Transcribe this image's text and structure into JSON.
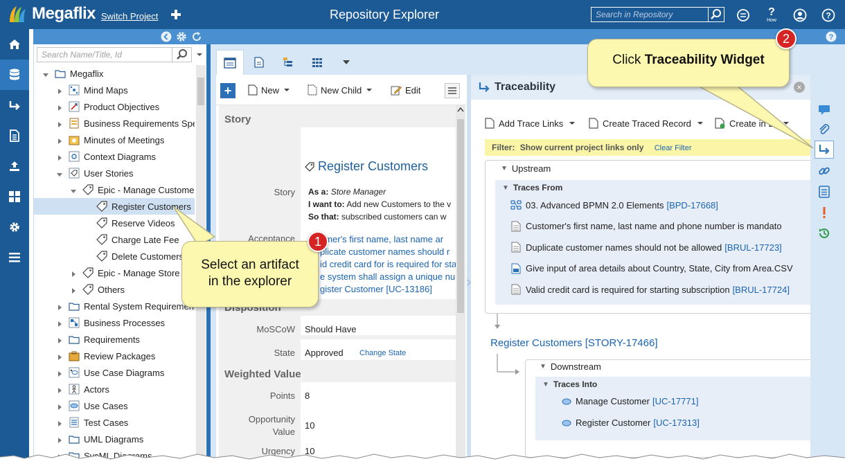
{
  "app": {
    "name": "Megaflix",
    "switch_project": "Switch Project",
    "page_title": "Repository Explorer",
    "search_placeholder": "Search in Repository",
    "how_label": "How"
  },
  "explorer": {
    "search_placeholder": "Search Name/Title, Id",
    "tree": [
      {
        "label": "Megaflix",
        "level": 0,
        "icon": "folder-icon",
        "expanded": true
      },
      {
        "label": "Mind Maps",
        "level": 1,
        "icon": "mindmap-icon"
      },
      {
        "label": "Product Objectives",
        "level": 1,
        "icon": "objective-icon"
      },
      {
        "label": "Business Requirements Spe",
        "level": 1,
        "icon": "brs-icon"
      },
      {
        "label": "Minutes of Meetings",
        "level": 1,
        "icon": "meeting-icon"
      },
      {
        "label": "Context Diagrams",
        "level": 1,
        "icon": "context-icon"
      },
      {
        "label": "User Stories",
        "level": 1,
        "icon": "story-folder-icon",
        "expanded": true
      },
      {
        "label": "Epic - Manage Customer",
        "level": 2,
        "icon": "epic-icon",
        "expanded": true
      },
      {
        "label": "Register Customers",
        "level": 3,
        "icon": "story-icon",
        "selected": true
      },
      {
        "label": "Reserve Videos",
        "level": 3,
        "icon": "story-icon"
      },
      {
        "label": "Charge Late Fee",
        "level": 3,
        "icon": "story-icon"
      },
      {
        "label": "Delete Customers",
        "level": 3,
        "icon": "story-icon"
      },
      {
        "label": "Epic - Manage Store",
        "level": 2,
        "icon": "epic-icon"
      },
      {
        "label": "Others",
        "level": 2,
        "icon": "epic-icon"
      },
      {
        "label": "Rental System Requirement",
        "level": 1,
        "icon": "folder-icon"
      },
      {
        "label": "Business Processes",
        "level": 1,
        "icon": "process-icon"
      },
      {
        "label": "Requirements",
        "level": 1,
        "icon": "folder-icon"
      },
      {
        "label": "Review Packages",
        "level": 1,
        "icon": "package-icon"
      },
      {
        "label": "Use Case Diagrams",
        "level": 1,
        "icon": "usecase-diagram-icon"
      },
      {
        "label": "Actors",
        "level": 1,
        "icon": "actor-icon"
      },
      {
        "label": "Use Cases",
        "level": 1,
        "icon": "usecase-icon"
      },
      {
        "label": "Test Cases",
        "level": 1,
        "icon": "testcase-icon"
      },
      {
        "label": "UML Diagrams",
        "level": 1,
        "icon": "folder-icon"
      },
      {
        "label": "SysML Diagrams",
        "level": 1,
        "icon": "folder-icon"
      }
    ]
  },
  "toolbar": {
    "new": "New",
    "new_child": "New Child",
    "edit": "Edit"
  },
  "detail": {
    "story_section": "Story",
    "title": "Register Customers",
    "story_label": "Story",
    "as_a_label": "As a:",
    "as_a_value": "Store Manager",
    "i_want_label": "I want to:",
    "i_want_value": "Add new Customers to the v",
    "so_that_label": "So that:",
    "so_that_value": "subscribed customers can w",
    "acceptance_label": "Acceptance",
    "acceptance_lines": [
      "omer's first name, last name ar",
      "plicate customer names should r",
      "id credit card for is required for sta",
      "e system shall assign a unique nu",
      "gister Customer [UC-13186]"
    ],
    "disposition_section": "Disposition",
    "moscow_label": "MoSCoW",
    "moscow_value": "Should Have",
    "state_label": "State",
    "state_value": "Approved",
    "change_state": "Change State",
    "weighted_section": "Weighted Value",
    "points_label": "Points",
    "points_value": "8",
    "opportunity_label_1": "Opportunity",
    "opportunity_label_2": "Value",
    "opportunity_value": "10",
    "urgency_label": "Urgency",
    "urgency_value": "10"
  },
  "traceability": {
    "title": "Traceability",
    "add_trace_links": "Add Trace Links",
    "create_traced_record": "Create Traced Record",
    "create_in_baseline": "Create in Ba",
    "filter_label": "Filter:",
    "filter_text": "Show current project links only",
    "clear_filter": "Clear Filter",
    "upstream": "Upstream",
    "traces_from": "Traces From",
    "upstream_items": [
      {
        "text": "03. Advanced BPMN 2.0 Elements",
        "ref": "[BPD-17668]",
        "icon": "bpmn-icon"
      },
      {
        "text": "Customer's first name, last name and phone number is mandato",
        "ref": "",
        "icon": "requirement-icon"
      },
      {
        "text": "Duplicate customer names should not be allowed",
        "ref": "[BRUL-17723]",
        "icon": "requirement-icon"
      },
      {
        "text": "Give input of area details about Country, State, City from Area.CSV",
        "ref": "",
        "icon": "document-icon"
      },
      {
        "text": "Valid credit card is required for starting subscription",
        "ref": "[BRUL-17724]",
        "icon": "requirement-icon"
      }
    ],
    "current": "Register Customers [STORY-17466]",
    "downstream": "Downstream",
    "traces_into": "Traces Into",
    "downstream_items": [
      {
        "text": "Manage Customer",
        "ref": "[UC-17771]"
      },
      {
        "text": "Register Customer",
        "ref": "[UC-17313]"
      }
    ]
  },
  "callouts": {
    "step1_number": "1",
    "step1_line1": "Select an artifact",
    "step1_line2": "in the explorer",
    "step2_number": "2",
    "step2_prefix": "Click ",
    "step2_bold": "Traceability Widget"
  },
  "colors": {
    "header": "#1c5a96",
    "accent": "#4a90d0",
    "callout": "#fdf8b0",
    "badge": "#d42424",
    "link": "#1a64b3"
  }
}
